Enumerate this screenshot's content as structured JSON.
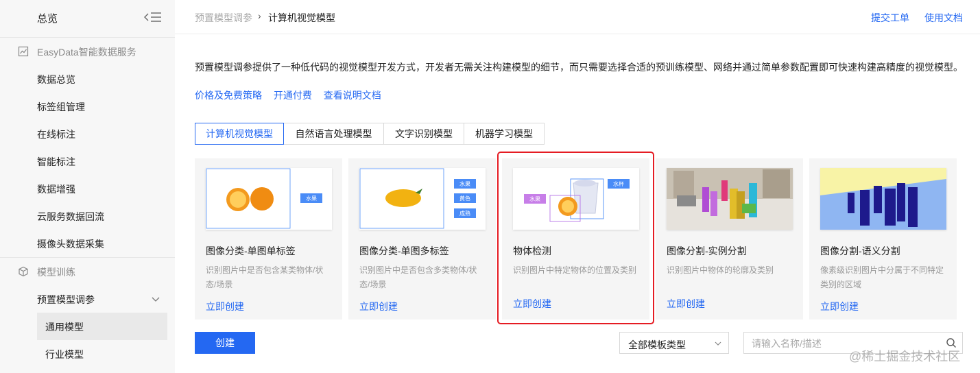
{
  "sidebar": {
    "title": "总览",
    "groups": [
      {
        "label": "EasyData智能数据服务",
        "icon": "chart-icon"
      },
      {
        "label": "模型训练",
        "icon": "cube-icon"
      }
    ],
    "data_items": [
      "数据总览",
      "标签组管理",
      "在线标注",
      "智能标注",
      "数据增强",
      "云服务数据回流",
      "摄像头数据采集"
    ],
    "train_parent": "预置模型调参",
    "train_children": [
      "通用模型",
      "行业模型"
    ]
  },
  "header": {
    "breadcrumb": [
      "预置模型调参",
      "计算机视觉模型"
    ],
    "links": [
      "提交工单",
      "使用文档"
    ]
  },
  "description": "预置模型调参提供了一种低代码的视觉模型开发方式，开发者无需关注构建模型的细节，而只需要选择合适的预训练模型、网络并通过简单参数配置即可快速构建高精度的视觉模型。",
  "quick_links": [
    "价格及免费策略",
    "开通付费",
    "查看说明文档"
  ],
  "tabs": [
    "计算机视觉模型",
    "自然语言处理模型",
    "文字识别模型",
    "机器学习模型"
  ],
  "cards": [
    {
      "title": "图像分类-单图单标签",
      "desc": "识别图片中是否包含某类物体/状态/场景",
      "action": "立即创建",
      "tags": [
        "水果"
      ]
    },
    {
      "title": "图像分类-单图多标签",
      "desc": "识别图片中是否包含多类物体/状态/场景",
      "action": "立即创建",
      "tags": [
        "水果",
        "黄色",
        "成熟"
      ]
    },
    {
      "title": "物体检测",
      "desc": "识别图片中特定物体的位置及类别",
      "action": "立即创建",
      "tags": [
        "水果",
        "水杯"
      ]
    },
    {
      "title": "图像分割-实例分割",
      "desc": "识别图片中物体的轮廓及类别",
      "action": "立即创建",
      "tags": []
    },
    {
      "title": "图像分割-语义分割",
      "desc": "像素级识别图片中分属于不同特定类别的区域",
      "action": "立即创建",
      "tags": []
    }
  ],
  "footer": {
    "create_label": "创建",
    "select_value": "全部模板类型",
    "search_placeholder": "请输入名称/描述"
  },
  "watermark": "@稀土掘金技术社区",
  "colors": {
    "accent": "#2468f2",
    "highlight": "#e51c23",
    "sidebar_bg": "#f7f7f7"
  }
}
